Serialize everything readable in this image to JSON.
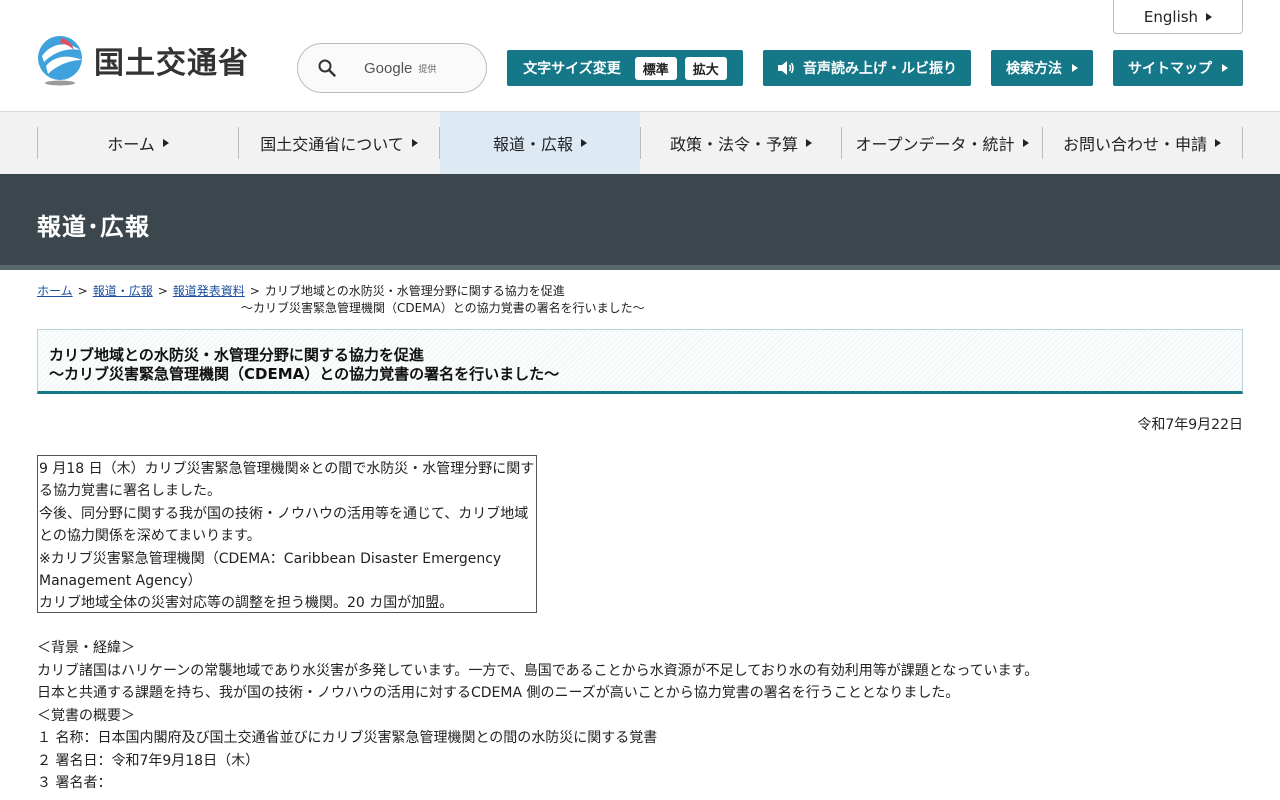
{
  "header": {
    "logo_text": "国土交通省",
    "english_label": "English",
    "search": {
      "brand": "Google",
      "brand_sub": "提供"
    },
    "font_size": {
      "label": "文字サイズ変更",
      "standard": "標準",
      "large": "拡大"
    },
    "voice_label": "音声読み上げ・ルビ振り",
    "search_method_label": "検索方法",
    "sitemap_label": "サイトマップ"
  },
  "nav": {
    "items": [
      {
        "label": "ホーム"
      },
      {
        "label": "国土交通省について"
      },
      {
        "label": "報道・広報"
      },
      {
        "label": "政策・法令・予算"
      },
      {
        "label": "オープンデータ・統計"
      },
      {
        "label": "お問い合わせ・申請"
      }
    ]
  },
  "banner": {
    "title": "報道･広報"
  },
  "breadcrumb": {
    "home": "ホーム",
    "press": "報道・広報",
    "releases": "報道発表資料",
    "current_line1": "カリブ地域との水防災・水管理分野に関する協力を促進",
    "current_line2": "～カリブ災害緊急管理機関（CDEMA）との協力覚書の署名を行いました～"
  },
  "article": {
    "title_line1": "カリブ地域との水防災・水管理分野に関する協力を促進",
    "title_line2": "～カリブ災害緊急管理機関（CDEMA）との協力覚書の署名を行いました～",
    "date": "令和7年9月22日",
    "summary": [
      "9 月18 日（木）カリブ災害緊急管理機関※との間で水防災・水管理分野に関す",
      "る協力覚書に署名しました。",
      "今後、同分野に関する我が国の技術・ノウハウの活用等を通じて、カリブ地域",
      "との協力関係を深めてまいります。",
      "※カリブ災害緊急管理機関（CDEMA：Caribbean Disaster Emergency",
      "Management Agency）",
      "カリブ地域全体の災害対応等の調整を担う機関。20 カ国が加盟。"
    ],
    "body": [
      "＜背景・経緯＞",
      "カリブ諸国はハリケーンの常襲地域であり水災害が多発しています。一方で、島国であることから水資源が不足しており水の有効利用等が課題となっています。",
      "日本と共通する課題を持ち、我が国の技術・ノウハウの活用に対するCDEMA 側のニーズが高いことから協力覚書の署名を行うこととなりました。",
      "＜覚書の概要＞",
      "１ 名称：日本国内閣府及び国土交通省並びにカリブ災害緊急管理機関との間の水防災に関する覚書",
      "２ 署名日：令和7年9月18日（木）",
      "３ 署名者："
    ]
  },
  "colors": {
    "accent": "#157889",
    "banner": "#3b474d",
    "nav_active": "#dde9f3"
  }
}
